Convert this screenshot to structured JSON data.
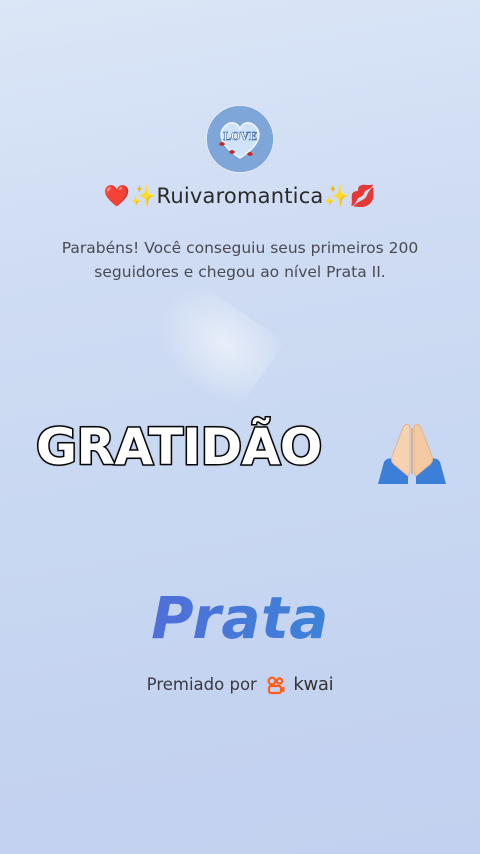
{
  "profile": {
    "username": "❤️✨Ruivaromantica✨💋",
    "avatar_text": "LOVE"
  },
  "message": "Parabéns! Você conseguiu seus primeiros 200 seguidores e chegou ao nível Prata II.",
  "overlay": {
    "caption": "GRATIDÃO",
    "emoji": "praying-hands-emoji"
  },
  "tier": {
    "name": "Prata"
  },
  "award": {
    "prefix": "Premiado por",
    "brand": "kwai",
    "brand_icon": "kwai-logo-icon",
    "brand_color": "#ff5e1a"
  },
  "colors": {
    "tier_blue": "#4a74d6",
    "background": "#c9d8f2"
  }
}
